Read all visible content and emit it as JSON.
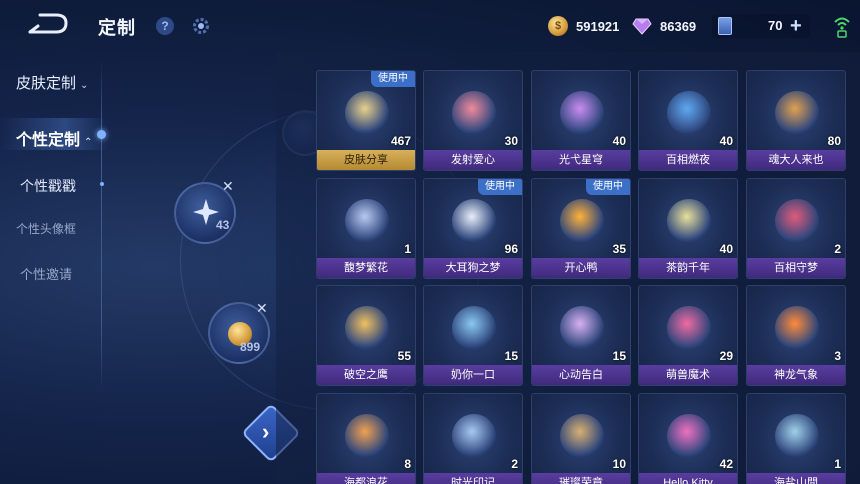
{
  "header": {
    "title": "定制",
    "help_glyph": "?",
    "currencies": [
      {
        "icon": "gold-coin-icon",
        "value": "591921"
      },
      {
        "icon": "gem-icon",
        "value": "86369"
      }
    ],
    "ticket": {
      "icon": "ticket-icon",
      "value": "70",
      "plus": "+"
    }
  },
  "sidebar": {
    "items": [
      {
        "label": "皮肤定制",
        "chevron": "⌄"
      },
      {
        "label": "个性定制",
        "chevron": "⌃"
      },
      {
        "label": "个性戳戳"
      },
      {
        "label": "个性头像框"
      },
      {
        "label": "个性邀请"
      }
    ]
  },
  "wheel": {
    "slots": [
      {
        "count": "43",
        "close": "✕"
      },
      {
        "count": "899",
        "close": "✕"
      }
    ],
    "arrow": "›"
  },
  "badge_in_use": "使用中",
  "cards": [
    {
      "name": "皮肤分享",
      "count": "467",
      "in_use": true,
      "gold": true
    },
    {
      "name": "发射爱心",
      "count": "30"
    },
    {
      "name": "光弋星穹",
      "count": "40"
    },
    {
      "name": "百相燃夜",
      "count": "40"
    },
    {
      "name": "魂大人来也",
      "count": "80"
    },
    {
      "name": "馥梦繁花",
      "count": "1"
    },
    {
      "name": "大耳狗之梦",
      "count": "96",
      "in_use": true
    },
    {
      "name": "开心鸭",
      "count": "35",
      "in_use": true
    },
    {
      "name": "茶韵千年",
      "count": "40"
    },
    {
      "name": "百相守梦",
      "count": "2"
    },
    {
      "name": "破空之鹰",
      "count": "55"
    },
    {
      "name": "奶你一口",
      "count": "15"
    },
    {
      "name": "心动告白",
      "count": "15"
    },
    {
      "name": "萌兽魔术",
      "count": "29"
    },
    {
      "name": "神龙气象",
      "count": "3"
    },
    {
      "name": "海都浪花",
      "count": "8"
    },
    {
      "name": "时光印记",
      "count": "2"
    },
    {
      "name": "璀璨荣章",
      "count": "10"
    },
    {
      "name": "Hello Kitty",
      "count": "42"
    },
    {
      "name": "海盐山間",
      "count": "1"
    }
  ],
  "colors": {
    "accent": "#3c6fc8",
    "label_purple": "#4a3290",
    "label_gold": "#c9a048"
  },
  "art_palette": [
    "#e8d08a",
    "#f08a9a",
    "#c98cf0",
    "#5fa8f0",
    "#e0a050",
    "#b8c8f0",
    "#e8eef8",
    "#ffb03a",
    "#e8e09a",
    "#e05a7a",
    "#f0c060",
    "#8ac8f0",
    "#d8b0f0",
    "#f06aa0",
    "#ff8a3a",
    "#f0a050",
    "#a8c8f0",
    "#d8b070",
    "#f070c0",
    "#a0d0e8"
  ]
}
